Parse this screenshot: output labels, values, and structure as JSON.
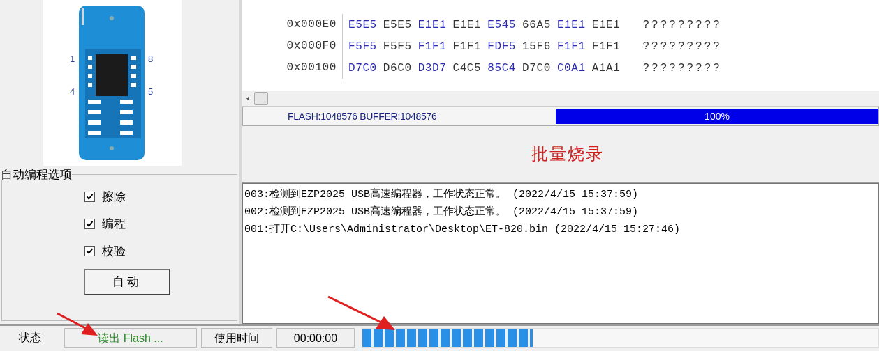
{
  "chip": {
    "pins": [
      {
        "label": "1"
      },
      {
        "label": "4"
      },
      {
        "label": "8"
      },
      {
        "label": "5"
      }
    ]
  },
  "hex": {
    "rows": [
      {
        "address": "0x000E0",
        "words": [
          "E5E5",
          "E5E5",
          "E1E1",
          "E1E1",
          "E545",
          "66A5",
          "E1E1",
          "E1E1"
        ],
        "ascii": "?????????"
      },
      {
        "address": "0x000F0",
        "words": [
          "F5F5",
          "F5F5",
          "F1F1",
          "F1F1",
          "FDF5",
          "15F6",
          "F1F1",
          "F1F1"
        ],
        "ascii": "?????????"
      },
      {
        "address": "0x00100",
        "words": [
          "D7C0",
          "D6C0",
          "D3D7",
          "C4C5",
          "85C4",
          "D7C0",
          "C0A1",
          "A1A1"
        ],
        "ascii": "?????????"
      }
    ]
  },
  "buffer_info": {
    "text": "FLASH:1048576 BUFFER:1048576",
    "progress": {
      "level": 1.0,
      "reading": "100%"
    }
  },
  "mode_title": "批量烧录",
  "log": [
    "003:检测到EZP2025 USB高速编程器，工作状态正常。 (2022/4/15 15:37:59)",
    "002:检测到EZP2025 USB高速编程器，工作状态正常。 (2022/4/15 15:37:59)",
    "001:打开C:\\Users\\Administrator\\Desktop\\ET-820.bin (2022/4/15 15:27:46)"
  ],
  "auto_options": {
    "title": "自动编程选项",
    "items": [
      {
        "label": "擦除",
        "checked": true
      },
      {
        "label": "编程",
        "checked": true
      },
      {
        "label": "校验",
        "checked": true
      }
    ],
    "button": "自动"
  },
  "status_bar": {
    "label": "状态",
    "status": "读出 Flash ...",
    "time_label": "使用时间",
    "time": "00:00:00",
    "progress": {
      "level": 0.33
    }
  }
}
